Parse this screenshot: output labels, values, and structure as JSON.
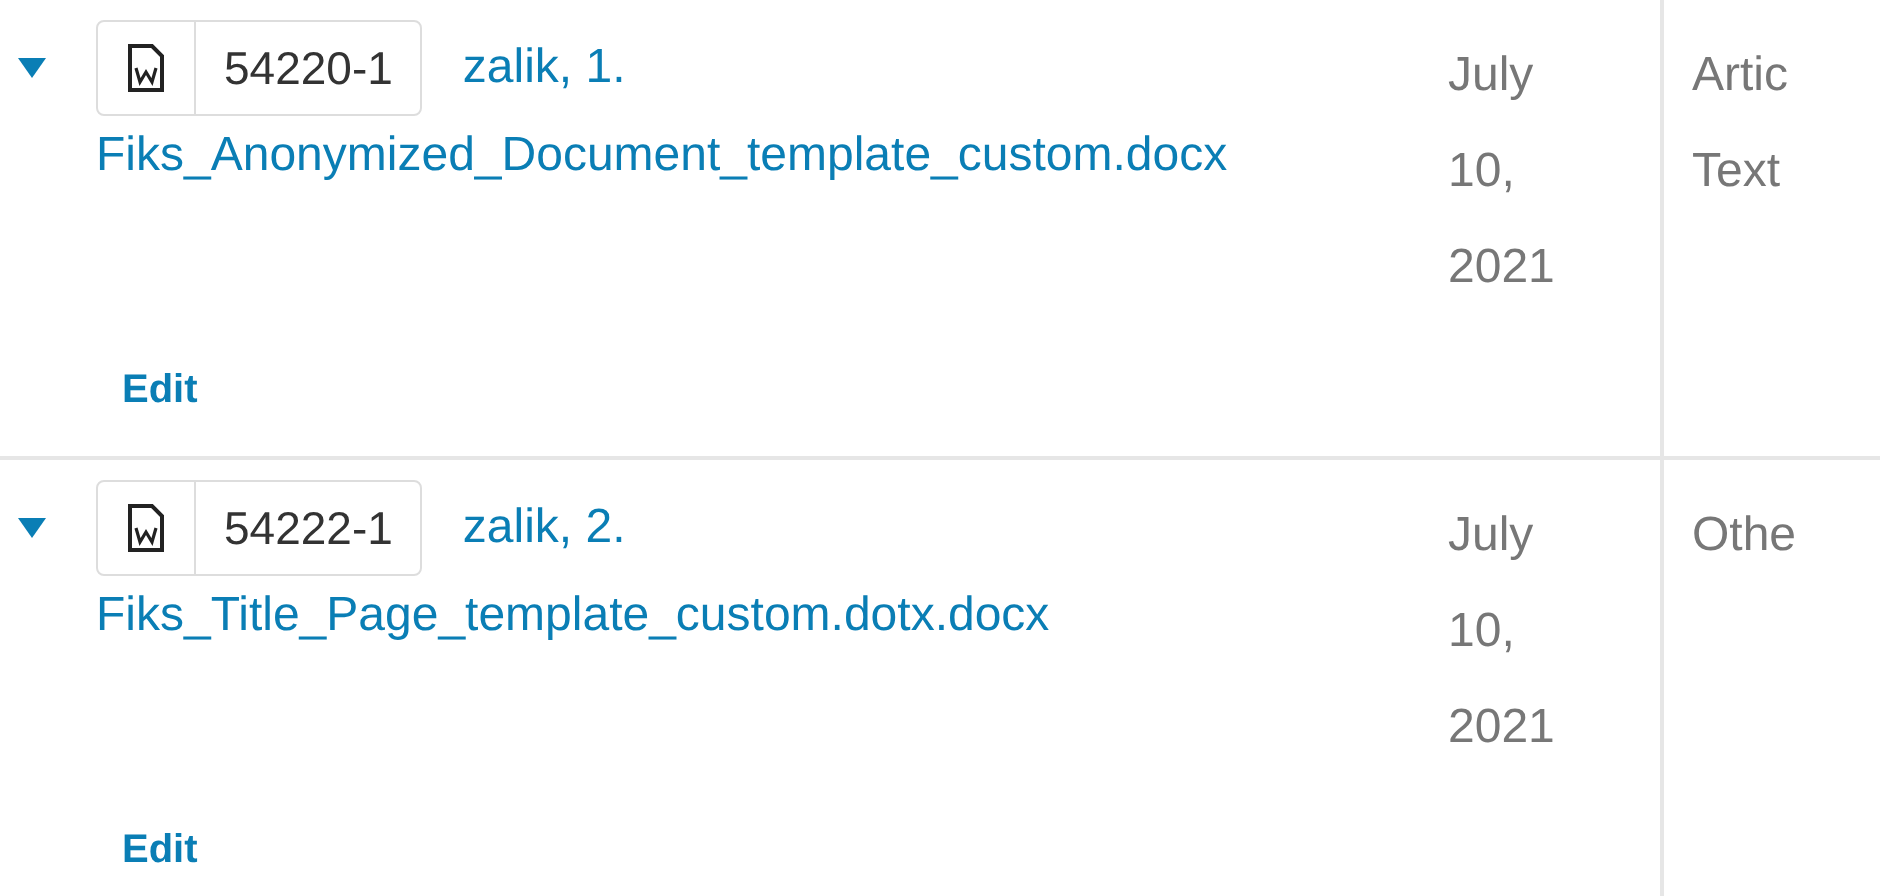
{
  "rows": [
    {
      "expanded": true,
      "id": "54220-1",
      "author": "zalik, 1.",
      "file": "Fiks_Anonymized_Document_template_custom.docx",
      "action": "Edit",
      "date": [
        "July",
        "10,",
        "2021"
      ],
      "type": [
        "Artic",
        "Text"
      ]
    },
    {
      "expanded": true,
      "id": "54222-1",
      "author": "zalik, 2.",
      "file": "Fiks_Title_Page_template_custom.dotx.docx",
      "action": "Edit",
      "date": [
        "July",
        "10,",
        "2021"
      ],
      "type": [
        "Othe"
      ]
    }
  ]
}
